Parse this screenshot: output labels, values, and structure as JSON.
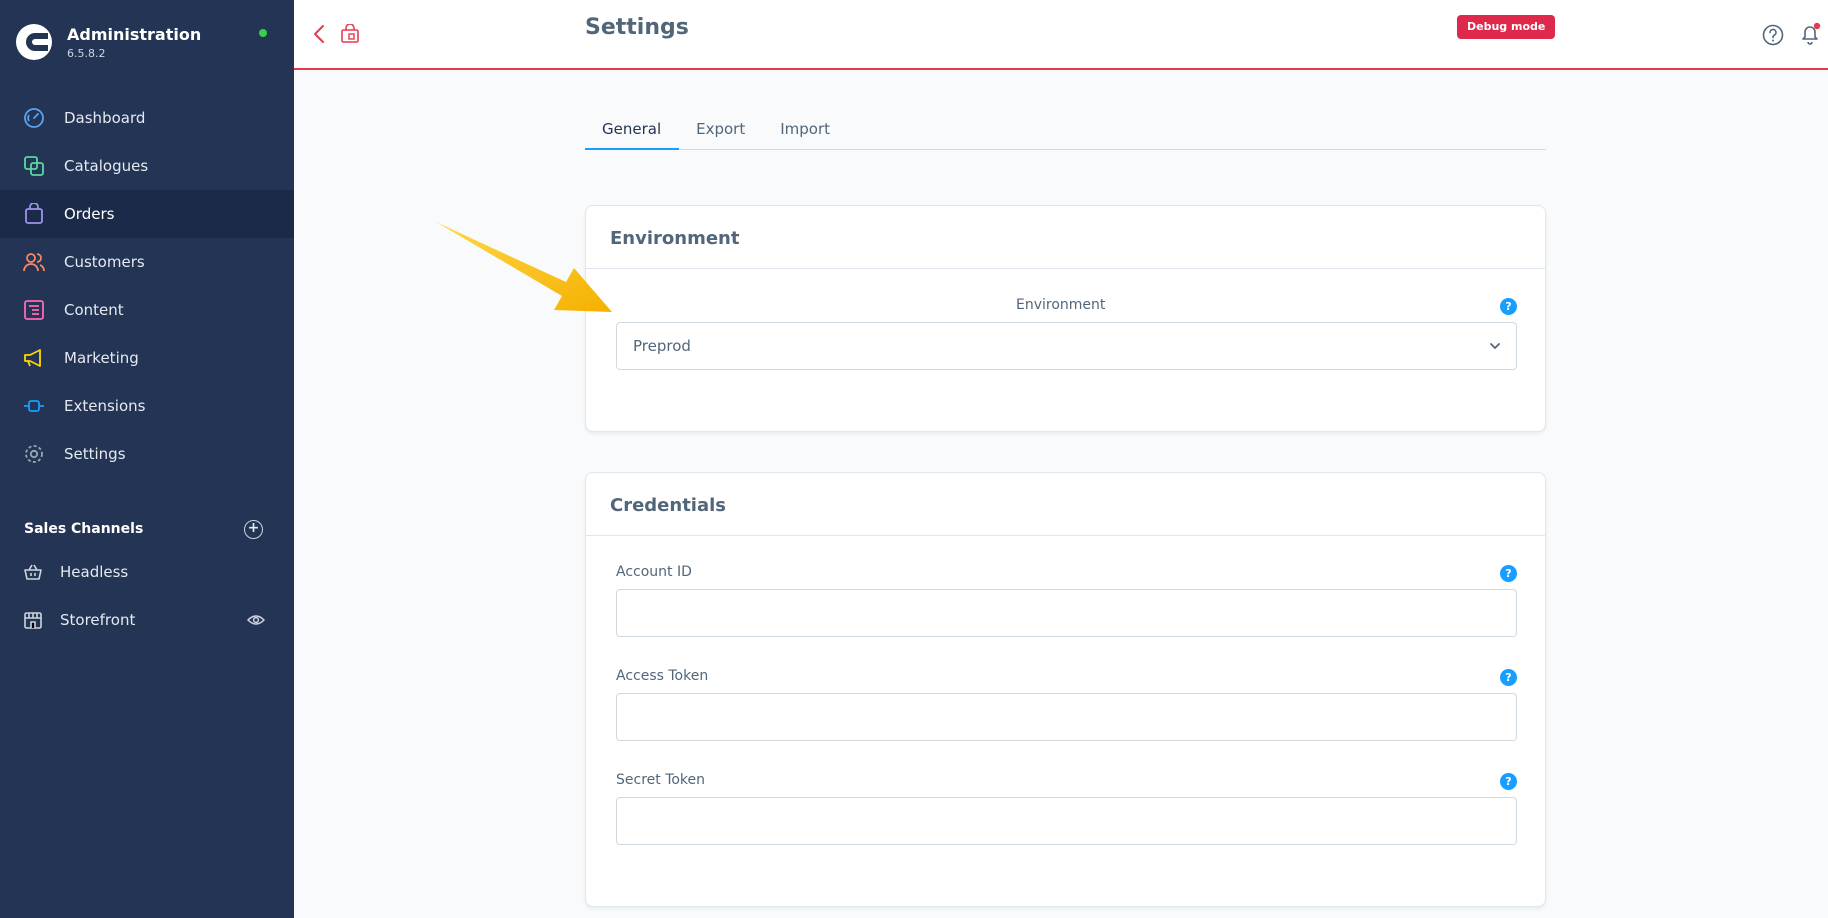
{
  "sidebar": {
    "app_title": "Administration",
    "version": "6.5.8.2",
    "nav": [
      {
        "label": "Dashboard",
        "icon": "dashboard-icon",
        "color": "#5aa4f5"
      },
      {
        "label": "Catalogues",
        "icon": "catalogues-icon",
        "color": "#57d9a3"
      },
      {
        "label": "Orders",
        "icon": "orders-icon",
        "color": "#a092f0"
      },
      {
        "label": "Customers",
        "icon": "customers-icon",
        "color": "#f88962"
      },
      {
        "label": "Content",
        "icon": "content-icon",
        "color": "#ff68b4"
      },
      {
        "label": "Marketing",
        "icon": "marketing-icon",
        "color": "#ffd700"
      },
      {
        "label": "Extensions",
        "icon": "extensions-icon",
        "color": "#189eff"
      },
      {
        "label": "Settings",
        "icon": "settings-icon",
        "color": "#9aa8b5"
      }
    ],
    "active": "Orders",
    "sales_channels": {
      "title": "Sales Channels",
      "items": [
        {
          "label": "Headless",
          "icon": "basket-icon"
        },
        {
          "label": "Storefront",
          "icon": "storefront-icon"
        }
      ]
    }
  },
  "header": {
    "title": "Settings",
    "debug_badge": "Debug mode"
  },
  "tabs": [
    {
      "label": "General",
      "active": true
    },
    {
      "label": "Export",
      "active": false
    },
    {
      "label": "Import",
      "active": false
    }
  ],
  "environment_card": {
    "title": "Environment",
    "field_label": "Environment",
    "selected_value": "Preprod"
  },
  "credentials_card": {
    "title": "Credentials",
    "fields": [
      {
        "label": "Account ID",
        "value": ""
      },
      {
        "label": "Access Token",
        "value": ""
      },
      {
        "label": "Secret Token",
        "value": ""
      }
    ]
  },
  "colors": {
    "sidebar_bg": "#243454",
    "accent": "#189eff",
    "header_border": "#e8394f",
    "debug_badge": "#de294c",
    "annotation_arrow": "#f5b800"
  }
}
